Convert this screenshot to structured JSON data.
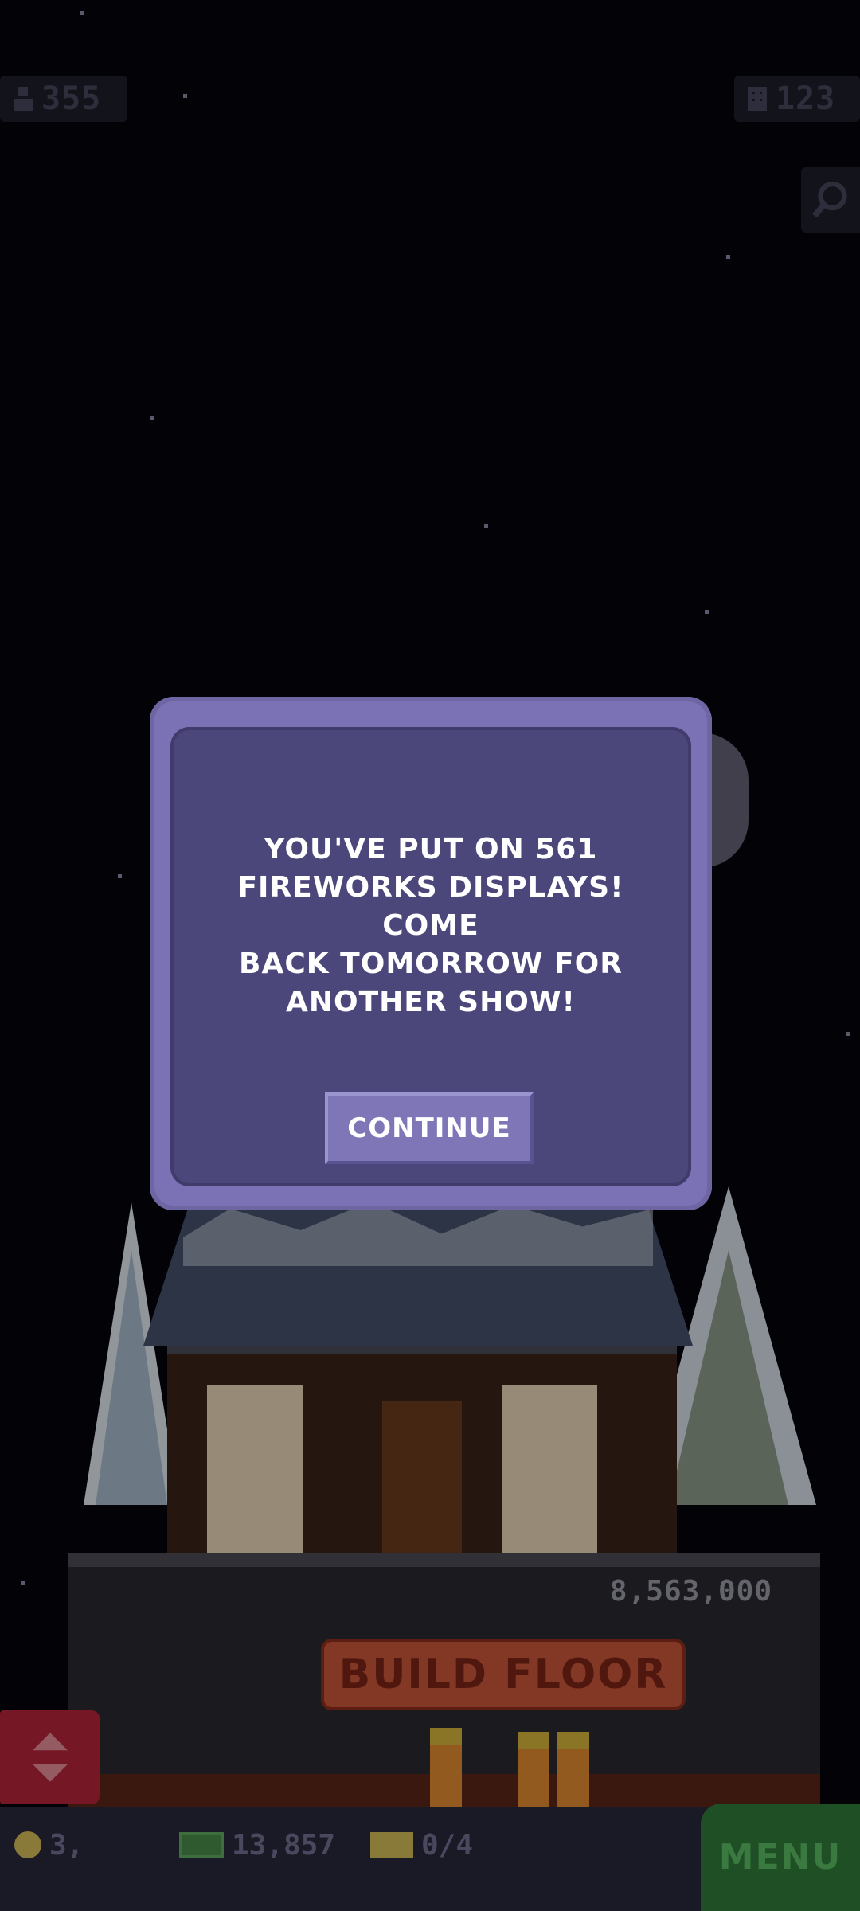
{
  "top_bar": {
    "population": "355",
    "floors": "123"
  },
  "building": {
    "build_cost": "8,563,000",
    "build_floor_label": "BUILD FLOOR"
  },
  "dialog": {
    "message": "YOU'VE PUT ON 561\nFIREWORKS DISPLAYS! COME\nBACK TOMORROW FOR\nANOTHER SHOW!",
    "continue_label": "CONTINUE"
  },
  "bottom_bar": {
    "coins": "3,",
    "bux": "13,857",
    "tickets": "0/4",
    "menu_label": "MENU"
  },
  "icons": {
    "population": "person-icon",
    "floors": "building-icon",
    "zoom": "magnifier-icon",
    "elevator": "up-down-arrows-icon",
    "coins": "coin-icon",
    "bux": "cash-icon",
    "tickets": "ticket-icon"
  },
  "colors": {
    "dialog_border": "#7b72b5",
    "dialog_fill": "#4c477b",
    "button_fill": "#7e76b6",
    "build_sign": "#c9573a",
    "menu_green": "#1f4f24"
  }
}
